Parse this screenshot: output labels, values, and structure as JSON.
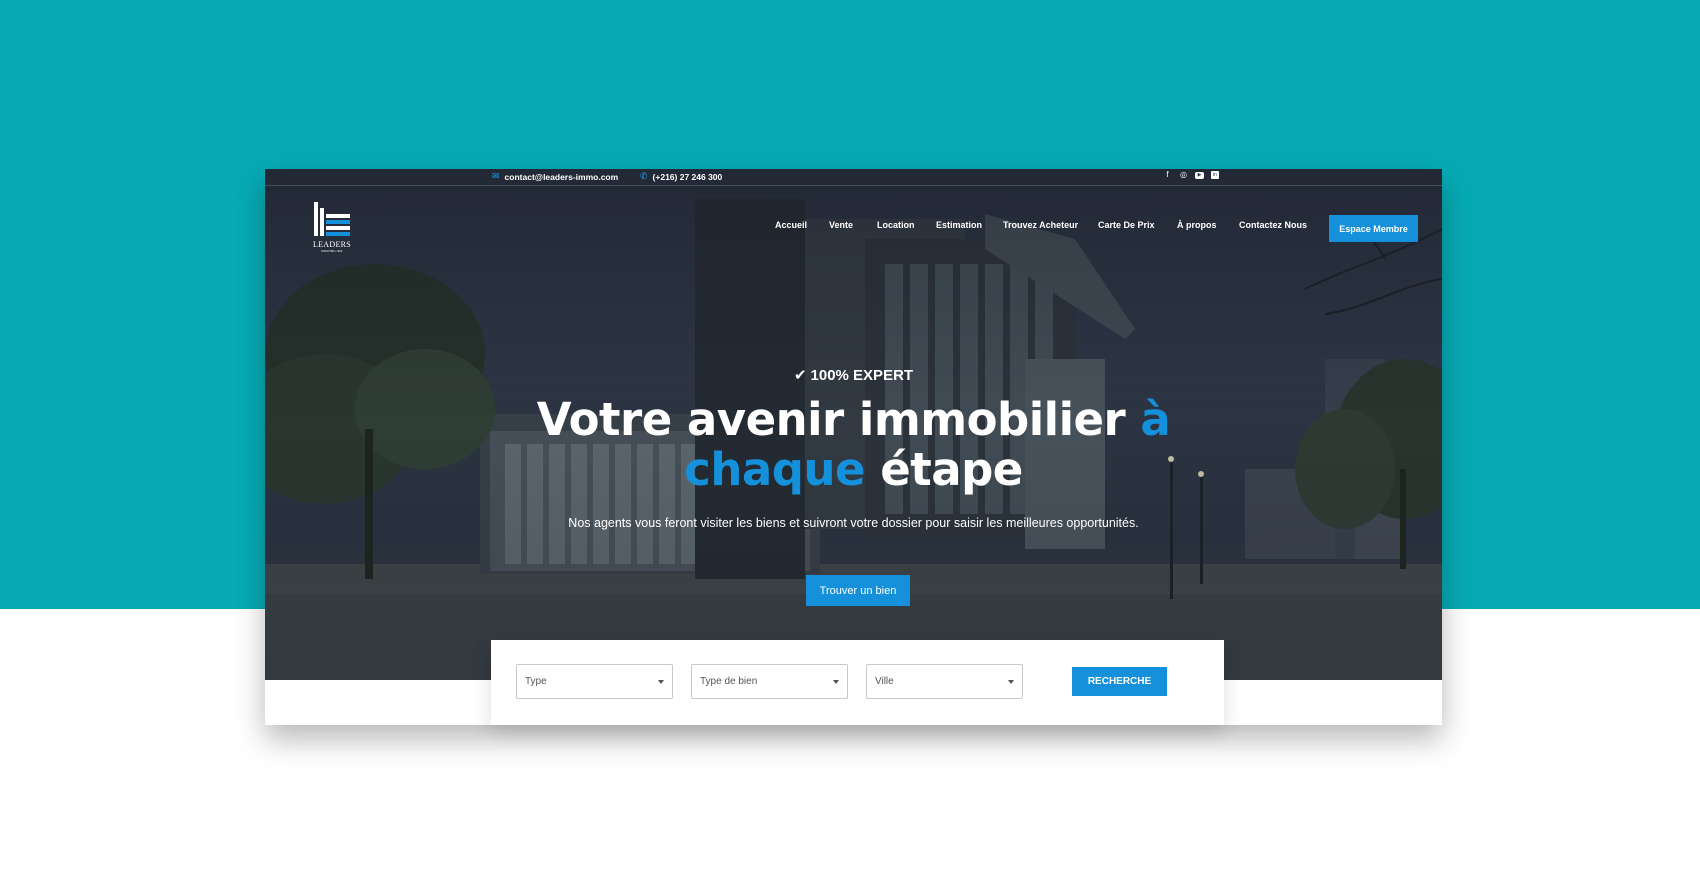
{
  "topbar": {
    "email": "contact@leaders-immo.com",
    "phone": "(+216) 27 246 300",
    "socials": [
      "facebook-icon",
      "instagram-icon",
      "youtube-icon",
      "linkedin-icon"
    ]
  },
  "logo": {
    "word": "LEADERS",
    "sub": "IMMOBILIER"
  },
  "nav": {
    "items": [
      {
        "label": "Accueil"
      },
      {
        "label": "Vente"
      },
      {
        "label": "Location"
      },
      {
        "label": "Estimation"
      },
      {
        "label": "Trouvez Acheteur"
      },
      {
        "label": "Carte De Prix"
      },
      {
        "label": "À propos"
      },
      {
        "label": "Contactez Nous"
      }
    ],
    "member_button": "Espace Membre"
  },
  "hero": {
    "badge": "100% EXPERT",
    "headline_part1": "Votre avenir immobilier ",
    "headline_accent1": "à",
    "headline_accent2": "chaque",
    "headline_part2": " étape",
    "subtitle": "Nos agents vous feront visiter les biens et suivront votre dossier pour saisir les meilleures opportunités.",
    "cta": "Trouver un bien"
  },
  "search": {
    "type_placeholder": "Type",
    "property_placeholder": "Type de bien",
    "city_placeholder": "Ville",
    "button": "RECHERCHE"
  },
  "colors": {
    "teal_background": "#06aab4",
    "accent_blue": "#1591db"
  }
}
